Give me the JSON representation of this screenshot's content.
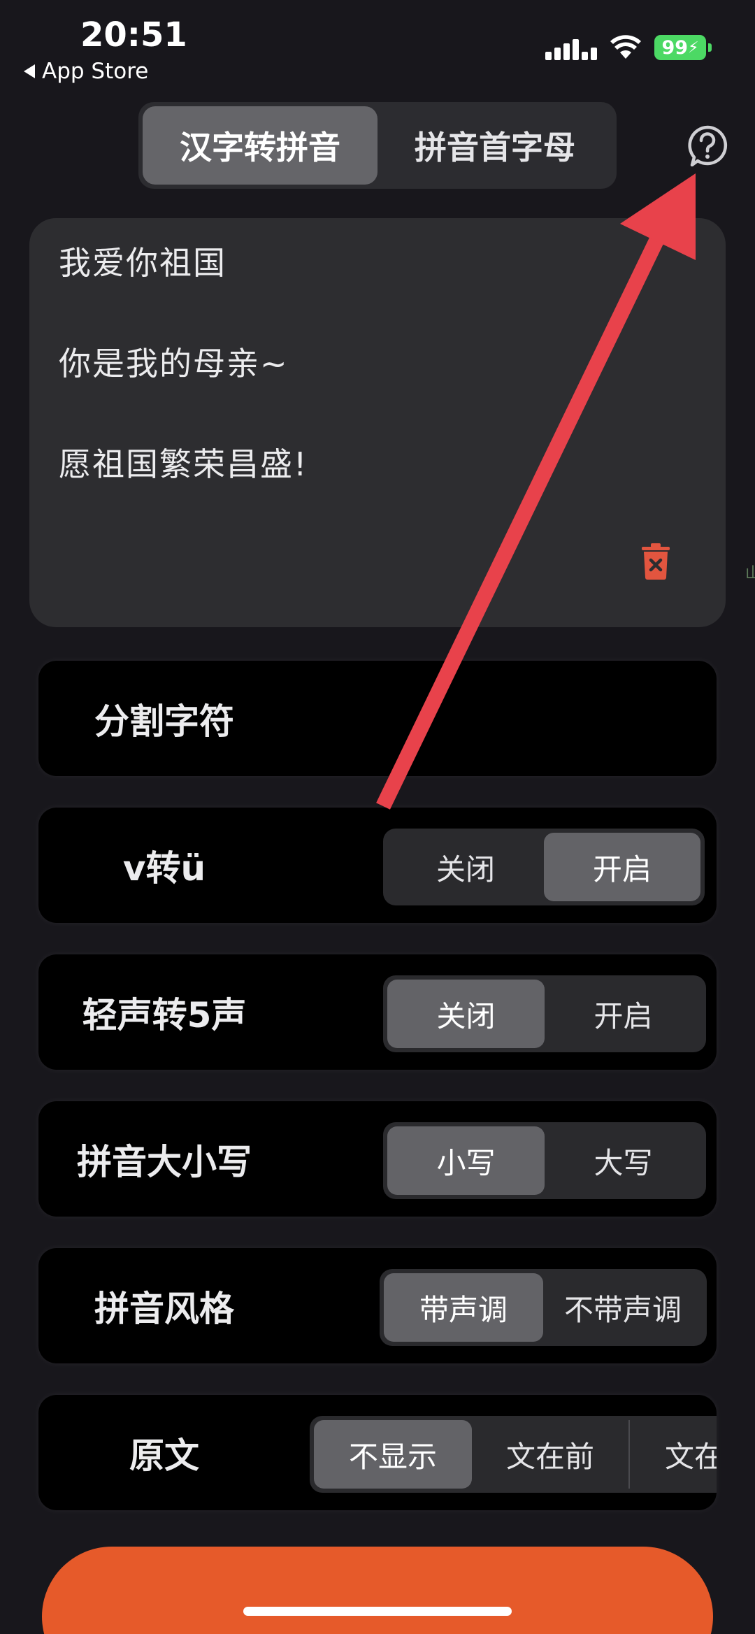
{
  "status_bar": {
    "time": "20:51",
    "back_label": "App Store",
    "battery": "99"
  },
  "mode_tabs": [
    {
      "label": "汉字转拼音",
      "active": true
    },
    {
      "label": "拼音首字母",
      "active": false
    }
  ],
  "input_text": {
    "lines": [
      "我爱你祖国",
      "你是我的母亲~",
      "愿祖国繁荣昌盛!"
    ]
  },
  "edge_glyph": "山",
  "settings": {
    "separator": {
      "label": "分割字符"
    },
    "v_to_u": {
      "label": "v转ü",
      "options": [
        "关闭",
        "开启"
      ],
      "selected": "开启"
    },
    "neutral_tone": {
      "label": "轻声转5声",
      "options": [
        "关闭",
        "开启"
      ],
      "selected": "关闭"
    },
    "case": {
      "label": "拼音大小写",
      "options": [
        "小写",
        "大写"
      ],
      "selected": "小写"
    },
    "style": {
      "label": "拼音风格",
      "options": [
        "带声调",
        "不带声调"
      ],
      "selected": "带声调"
    },
    "original": {
      "label": "原文",
      "options": [
        "不显示",
        "文在前",
        "文在后"
      ],
      "visible_last": "文在/",
      "selected": "不显示"
    }
  },
  "colors": {
    "accent_orange": "#e65a2a",
    "annotation_red": "#e8424b",
    "battery_green": "#4cd964",
    "trash_red": "#e2553f"
  },
  "icons": [
    "help-icon",
    "trash-icon",
    "signal-icon",
    "wifi-icon",
    "battery-icon",
    "back-triangle-icon"
  ]
}
